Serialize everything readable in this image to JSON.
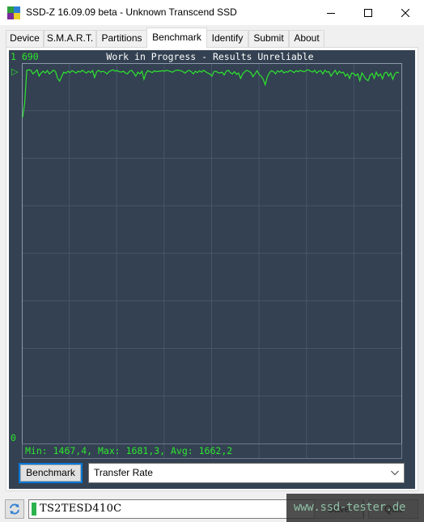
{
  "window": {
    "title": "SSD-Z 16.09.09 beta - Unknown Transcend SSD",
    "controls": {
      "minimize": "minimize",
      "maximize": "maximize",
      "close": "close"
    }
  },
  "tabs": [
    {
      "label": "Device",
      "active": false
    },
    {
      "label": "S.M.A.R.T.",
      "active": false
    },
    {
      "label": "Partitions",
      "active": false
    },
    {
      "label": "Benchmark",
      "active": true
    },
    {
      "label": "Identify",
      "active": false
    },
    {
      "label": "Submit",
      "active": false
    },
    {
      "label": "About",
      "active": false
    }
  ],
  "benchmark": {
    "button_label": "Benchmark",
    "mode_selected": "Transfer Rate"
  },
  "status_bar": {
    "drive_name": "TS2TESD410C",
    "drive_led_color": "#2bb24c",
    "save_label": "Save",
    "quit_label": "Quit"
  },
  "watermark": {
    "text": "www.ssd-tester.de"
  },
  "chart_data": {
    "type": "line",
    "title": "Work in Progress - Results Unreliable",
    "y_max_label": "1 690",
    "y_min_label": "0",
    "ylim": [
      0,
      1690
    ],
    "grid": true,
    "grid_columns": 8,
    "grid_rows": 8,
    "line_color": "#2ee62e",
    "background_color": "#334152",
    "stats_label": "Min: 1467,4, Max: 1681,3, Avg: 1662,2",
    "stats": {
      "min": 1467.4,
      "max": 1681.3,
      "avg": 1662.2
    },
    "series": [
      {
        "name": "Transfer Rate",
        "values": [
          1467,
          1530,
          1676,
          1678,
          1676,
          1660,
          1668,
          1678,
          1650,
          1664,
          1672,
          1664,
          1675,
          1660,
          1668,
          1677,
          1670,
          1640,
          1628,
          1650,
          1668,
          1663,
          1672,
          1666,
          1675,
          1670,
          1664,
          1672,
          1668,
          1676,
          1670,
          1664,
          1672,
          1666,
          1675,
          1644,
          1670,
          1676,
          1668,
          1672,
          1668,
          1660,
          1670,
          1675,
          1678,
          1672,
          1675,
          1670,
          1668,
          1672,
          1664,
          1660,
          1672,
          1676,
          1664,
          1650,
          1668,
          1660,
          1672,
          1636,
          1664,
          1675,
          1670,
          1666,
          1674,
          1670,
          1672,
          1672,
          1674,
          1672,
          1676,
          1674,
          1670,
          1668,
          1674,
          1677,
          1676,
          1674,
          1670,
          1664,
          1672,
          1676,
          1670,
          1660,
          1672,
          1666,
          1674,
          1668,
          1676,
          1670,
          1664,
          1660,
          1650,
          1670,
          1672,
          1666,
          1664,
          1668,
          1655,
          1672,
          1676,
          1666,
          1660,
          1670,
          1658,
          1664,
          1640,
          1660,
          1670,
          1676,
          1672,
          1666,
          1648,
          1660,
          1674,
          1658,
          1650,
          1636,
          1612,
          1648,
          1664,
          1675,
          1670,
          1660,
          1674,
          1668,
          1676,
          1664,
          1670,
          1668,
          1676,
          1672,
          1666,
          1674,
          1670,
          1676,
          1672,
          1670,
          1676,
          1678,
          1672,
          1668,
          1676,
          1664,
          1672,
          1674,
          1660,
          1676,
          1668,
          1670,
          1650,
          1664,
          1676,
          1658,
          1672,
          1664,
          1668,
          1650,
          1660,
          1640,
          1664,
          1662,
          1652,
          1660,
          1630,
          1664,
          1650,
          1636,
          1630,
          1654,
          1662,
          1640,
          1668,
          1650,
          1660,
          1638,
          1664,
          1668,
          1650,
          1664,
          1636,
          1660,
          1668,
          1664
        ]
      }
    ]
  }
}
